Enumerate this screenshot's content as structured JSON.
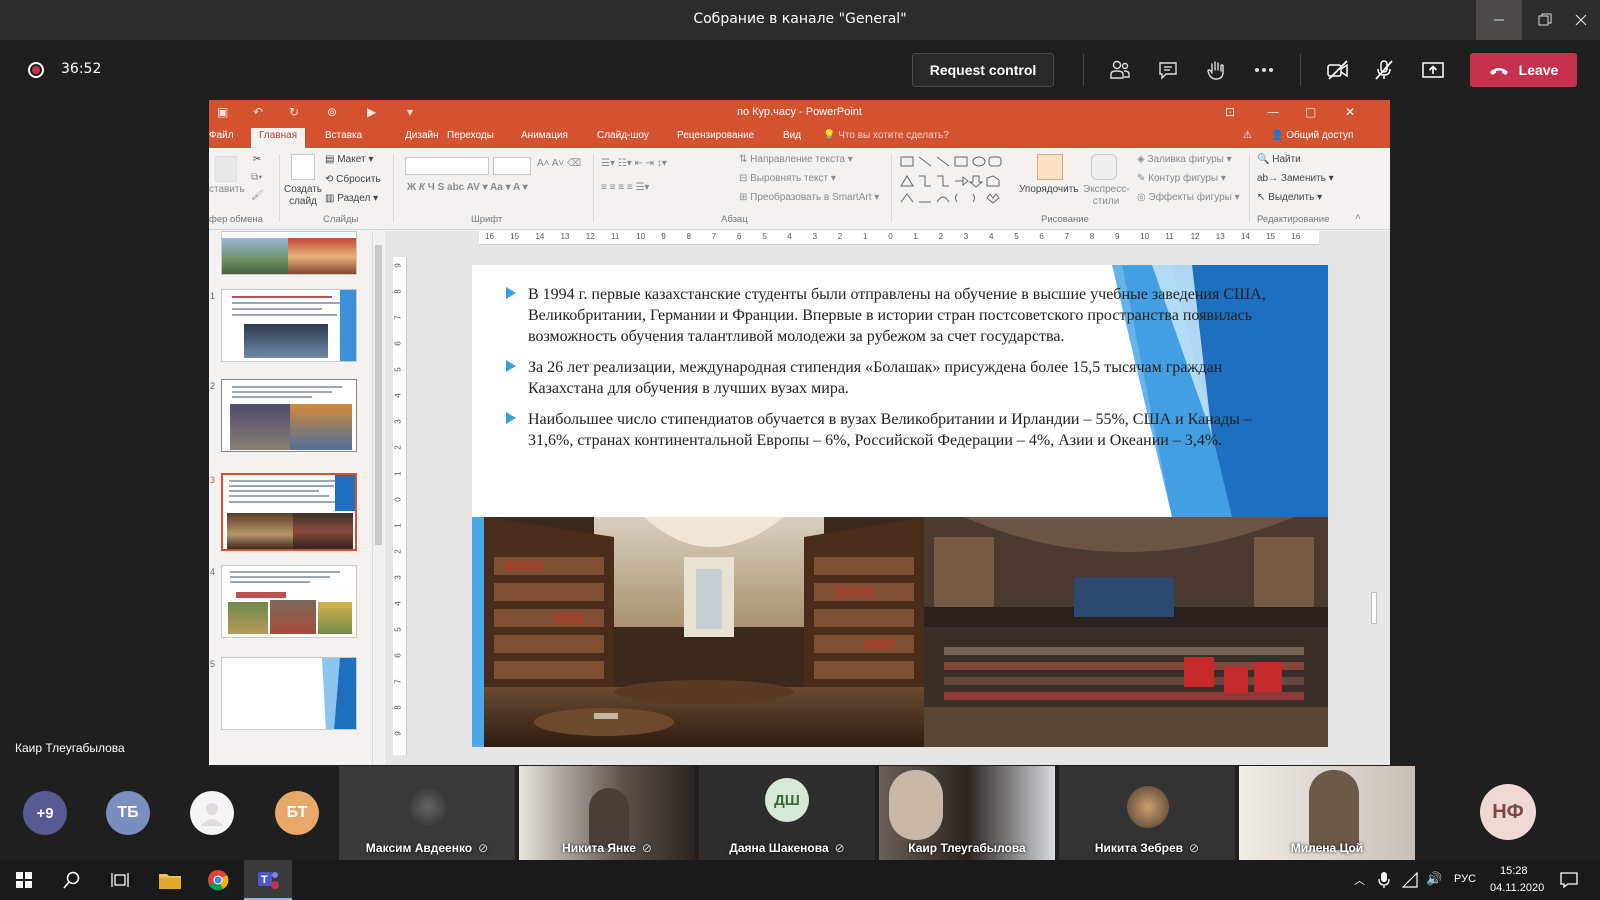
{
  "window": {
    "title": "Собрание в канале \"General\""
  },
  "meeting": {
    "timer": "36:52",
    "request_control_label": "Request control",
    "leave_label": "Leave",
    "presenter_name": "Каир Тлеугабылова"
  },
  "powerpoint": {
    "title": "по Кур.часу - PowerPoint",
    "tabs": [
      "Файл",
      "Главная",
      "Вставка",
      "Дизайн",
      "Переходы",
      "Анимация",
      "Слайд-шоу",
      "Рецензирование",
      "Вид"
    ],
    "tell_me": "Что вы хотите сделать?",
    "share": "Общий доступ",
    "ribbon": {
      "paste": "ставить",
      "clipboard_group": "фер обмена",
      "new_slide": "Создать слайд",
      "layout": "Макет",
      "reset": "Сбросить",
      "section": "Раздел",
      "slides_group": "Слайды",
      "font_group": "Шрифт",
      "text_direction": "Направление текста",
      "align_text": "Выровнять текст",
      "smartart": "Преобразовать в SmartArt",
      "paragraph_group": "Абзац",
      "arrange": "Упорядочить",
      "quick_styles": "Экспресс-стили",
      "shape_fill": "Заливка фигуры",
      "shape_outline": "Контур фигуры",
      "shape_effects": "Эффекты фигуры",
      "drawing_group": "Рисование",
      "find": "Найти",
      "replace": "Заменить",
      "select": "Выделить",
      "editing_group": "Редактирование"
    },
    "thumb_numbers": [
      "1",
      "2",
      "3",
      "4",
      "5"
    ],
    "ruler_h": [
      "16",
      "15",
      "14",
      "13",
      "12",
      "11",
      "10",
      "9",
      "8",
      "7",
      "6",
      "5",
      "4",
      "3",
      "2",
      "1",
      "0",
      "1",
      "2",
      "3",
      "4",
      "5",
      "6",
      "7",
      "8",
      "9",
      "10",
      "11",
      "12",
      "13",
      "14",
      "15",
      "16"
    ],
    "ruler_v": [
      "9",
      "8",
      "7",
      "6",
      "5",
      "4",
      "3",
      "2",
      "1",
      "0",
      "1",
      "2",
      "3",
      "4",
      "5",
      "6",
      "7",
      "8",
      "9"
    ]
  },
  "slide": {
    "bullets": [
      "В 1994 г. первые казахстанские студенты были отправлены на обучение в высшие учебные заведения США, Великобритании, Германии и Франции. Впервые в истории стран постсоветского пространства появилась возможность обучения талантливой молодежи за рубежом за счет государства.",
      "За 26 лет реализации, международная стипендия «Болашак» присуждена более 15,5 тысячам граждан Казахстана для обучения в лучших вузах мира.",
      " Наибольшее число стипендиатов обучается в вузах  Великобритании и Ирландии – 55%, США и Канады – 31,6%, странах континентальной Европы – 6%, Российской Федерации – 4%, Азии и Океании – 3,4%."
    ]
  },
  "participants": {
    "overflow": "+9",
    "initials": [
      "ТБ",
      "",
      "БТ",
      "ДШ",
      "НФ"
    ],
    "names": [
      "Максим Авдеенко",
      "Никита Янке",
      "Даяна Шакенова",
      "Каир Тлеугабылова",
      "Никита Зебрев",
      "Милена Цой"
    ]
  },
  "taskbar": {
    "lang": "РУС",
    "time": "15:28",
    "date": "04.11.2020"
  },
  "colors": {
    "teams_bg": "#1f1f1f",
    "leave": "#c4314b",
    "ppt_accent": "#d35230",
    "slide_blue": "#1e6fbf"
  }
}
